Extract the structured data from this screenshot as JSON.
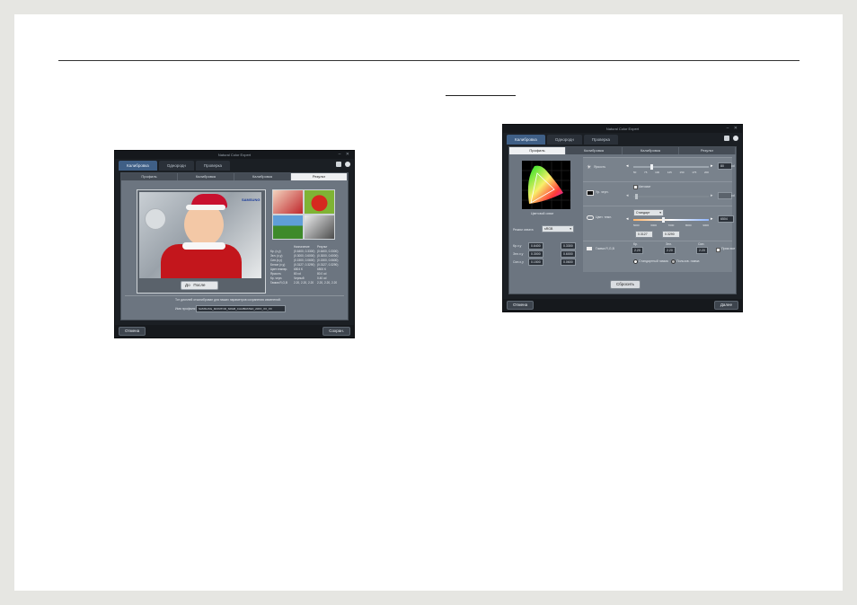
{
  "left_window": {
    "title": "Natural Color Expert",
    "tabs": [
      "Калибровка",
      "Однородн",
      "Проверка"
    ],
    "steps": [
      "Профиль",
      "Калибровка",
      "Калибровка",
      "Результ"
    ],
    "samsung_logo": "SAMSUNG",
    "before_after": {
      "before": "До",
      "after": "После"
    },
    "table_headers": [
      "",
      "Назначение",
      "Результ"
    ],
    "table_rows": [
      [
        "Кр. (x,y)",
        "(0.6400, 0.3300)",
        "(0.6400, 0.3300)"
      ],
      [
        "Зел. (x,y)",
        "(0.3000, 0.6000)",
        "(0.3000, 0.6000)"
      ],
      [
        "Син.(x,y)",
        "(0.1500, 0.0600)",
        "(0.1500, 0.0600)"
      ],
      [
        "Белое (x,y)",
        "(0.3127, 0.3290)",
        "(0.3127, 0.3290)"
      ],
      [
        "Цвет.темпер.",
        "6504 K",
        "6500 K"
      ],
      [
        "Яркость",
        "80 cd",
        "80.0 cd"
      ],
      [
        "Кр. черн.",
        "Черный",
        "0.40 cd"
      ],
      [
        "Гамма R,G,B",
        "2.20, 2.20, 2.20",
        "2.20, 2.20, 2.20"
      ]
    ],
    "message": "Тот дисплей откалиброван для наших параметров сохранения изменений.",
    "profile_label": "Имя профиля",
    "profile_value": "SAMSUNG_MONITOR_SRGB_CALIBRATED_20XX_XX_XX",
    "cancel_button": "Отмена",
    "save_button": "Сохран."
  },
  "right_window": {
    "title": "Natural Color Expert",
    "tabs": [
      "Калибровка",
      "Однородн",
      "Проверка"
    ],
    "steps": [
      "Профиль",
      "Калибровка",
      "Калибровка",
      "Результ"
    ],
    "gamut_label": "Цветовой охват",
    "colorspace_label": "Режим охвата",
    "colorspace_value": "sRGB",
    "coords": [
      {
        "label": "Кр.x,y",
        "x": "0.6400",
        "y": "0.3300"
      },
      {
        "label": "Зел.x,y",
        "x": "0.3000",
        "y": "0.6000"
      },
      {
        "label": "Син.x,y",
        "x": "0.1500",
        "y": "0.0600"
      }
    ],
    "brightness_label": "Яркость",
    "brightness_value": "80",
    "brightness_unit": "cd",
    "brightness_ticks": [
      "50",
      "75",
      "100",
      "125",
      "150",
      "175",
      "200"
    ],
    "black_label": "Ур. черн.",
    "auto_label": "Автомат",
    "black_unit": "cd",
    "temp_label": "Цвет. темп.",
    "temp_mode": "Стандарт",
    "temp_value": "6504",
    "temp_ticks": [
      "5000",
      "6000",
      "7000",
      "8000",
      "9000"
    ],
    "white_x": "0.3127",
    "white_y": "0.3290",
    "gamma_label": "Гамма R,G,B",
    "gamma_channels": [
      "Кр.",
      "Зел.",
      "Син."
    ],
    "gamma_values": [
      "2.20",
      "2.20",
      "2.20"
    ],
    "link_label": "Прим.все",
    "radio_standard": "Стандартный гамма",
    "radio_custom": "Пользов. гамма",
    "reset_button": "Сбросить",
    "cancel_button": "Отмена",
    "next_button": "Далее"
  }
}
